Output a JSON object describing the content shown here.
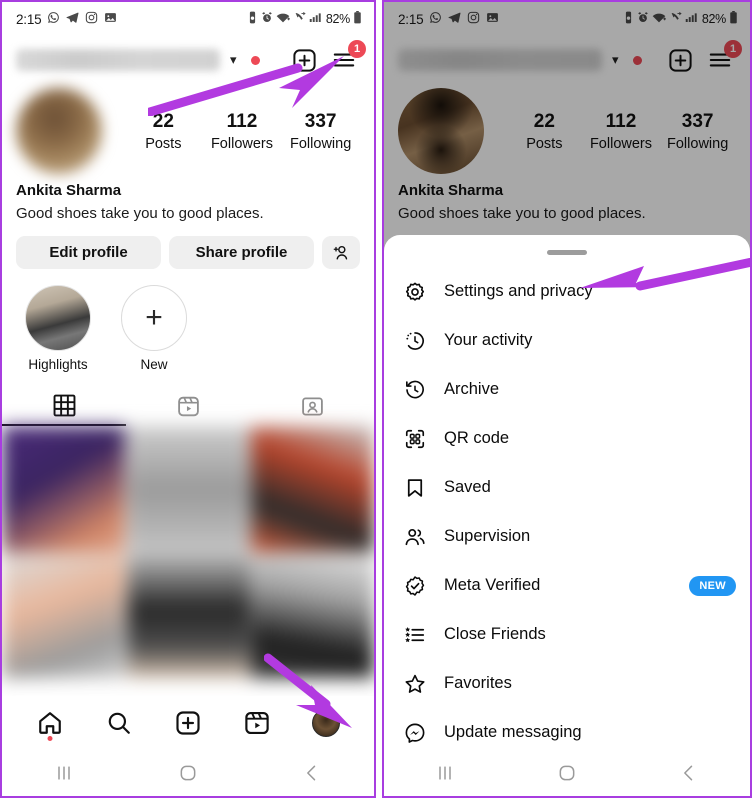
{
  "meta": {
    "accent_arrow_color": "#b23ae0",
    "frame_border_color": "#a83de0",
    "badge_red": "#ed4956",
    "new_badge_blue": "#2196f3"
  },
  "status_bar": {
    "time": "2:15",
    "battery": "82%",
    "left_icons": [
      "whatsapp-icon",
      "telegram-icon",
      "instagram-icon",
      "gallery-icon"
    ],
    "right_icons": [
      "vibrate-icon",
      "alarm-icon",
      "wifi-icon",
      "call-forward-icon",
      "signal-icon",
      "battery-icon"
    ]
  },
  "app_bar": {
    "username_masked": "",
    "chevron": "chevron-down-icon",
    "has_unread_dot": true,
    "add_label": "add-post-icon",
    "menu_label": "hamburger-menu-icon",
    "menu_badge": "1"
  },
  "profile": {
    "stats": [
      {
        "value": "22",
        "label": "Posts"
      },
      {
        "value": "112",
        "label": "Followers"
      },
      {
        "value": "337",
        "label": "Following"
      }
    ],
    "name": "Ankita Sharma",
    "bio": "Good shoes take you to good places."
  },
  "actions": {
    "edit_profile": "Edit profile",
    "share_profile": "Share profile",
    "add_person": "add-person-icon"
  },
  "highlights": [
    {
      "label": "Highlights",
      "type": "cover"
    },
    {
      "label": "New",
      "type": "new"
    }
  ],
  "tabs": [
    {
      "name": "grid-tab",
      "icon": "grid-icon",
      "active": true
    },
    {
      "name": "reels-tab",
      "icon": "reels-icon",
      "active": false
    },
    {
      "name": "tagged-tab",
      "icon": "tagged-icon",
      "active": false
    }
  ],
  "bottom_nav": [
    {
      "name": "home",
      "icon": "home-icon",
      "dot": true
    },
    {
      "name": "search",
      "icon": "search-icon",
      "dot": false
    },
    {
      "name": "create",
      "icon": "plus-box-icon",
      "dot": false
    },
    {
      "name": "reels",
      "icon": "reels-icon",
      "dot": false
    },
    {
      "name": "profile",
      "icon": "profile-avatar-icon",
      "dot": false
    }
  ],
  "system_nav": [
    {
      "name": "recents",
      "icon": "recents-icon"
    },
    {
      "name": "home",
      "icon": "home-circle-icon"
    },
    {
      "name": "back",
      "icon": "back-chevron-icon"
    }
  ],
  "menu_sheet": {
    "items": [
      {
        "label": "Settings and privacy",
        "icon": "settings-gear-icon",
        "badge": ""
      },
      {
        "label": "Your activity",
        "icon": "activity-clock-icon",
        "badge": ""
      },
      {
        "label": "Archive",
        "icon": "archive-clock-icon",
        "badge": ""
      },
      {
        "label": "QR code",
        "icon": "qr-code-icon",
        "badge": ""
      },
      {
        "label": "Saved",
        "icon": "bookmark-icon",
        "badge": ""
      },
      {
        "label": "Supervision",
        "icon": "supervision-people-icon",
        "badge": ""
      },
      {
        "label": "Meta Verified",
        "icon": "verified-badge-icon",
        "badge": "NEW"
      },
      {
        "label": "Close Friends",
        "icon": "close-friends-list-icon",
        "badge": ""
      },
      {
        "label": "Favorites",
        "icon": "star-icon",
        "badge": ""
      },
      {
        "label": "Update messaging",
        "icon": "messenger-icon",
        "badge": ""
      }
    ]
  }
}
